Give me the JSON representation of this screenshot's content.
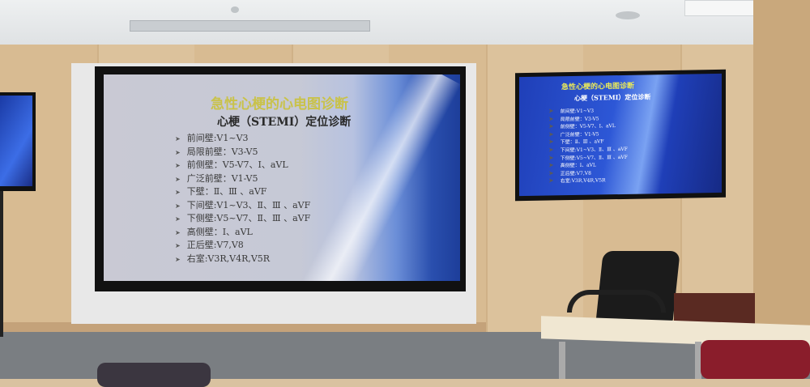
{
  "projection_screen": {
    "title": "急性心梗的心电图诊断",
    "subtitle": "心梗（STEMI）定位诊断",
    "items": [
      "前间壁:V1~V3",
      "局限前壁：V3-V5",
      "前侧壁：V5-V7、Ⅰ、aVL",
      "广泛前壁：V1-V5",
      "下壁：Ⅱ、Ⅲ 、aVF",
      "下间壁:V1~V3、Ⅱ、Ⅲ 、aVF",
      "下侧壁:V5~V7、Ⅱ、Ⅲ 、aVF",
      "高侧壁：Ⅰ、aVL",
      "正后壁:V7,V8",
      "右室:V3R,V4R,V5R"
    ]
  },
  "tv_screen": {
    "title": "急性心梗的心电图诊断",
    "subtitle": "心梗（STEMI）定位诊断",
    "items": [
      "前间壁:V1~V3",
      "局限前壁：V3-V5",
      "前侧壁：V5-V7、Ⅰ、aVL",
      "广泛前壁：V1-V5",
      "下壁：Ⅱ、Ⅲ 、aVF",
      "下间壁:V1~V3、Ⅱ、Ⅲ 、aVF",
      "下侧壁:V5~V7、Ⅱ、Ⅲ 、aVF",
      "高侧壁：Ⅰ、aVL",
      "正后壁:V7,V8",
      "右室:V3R,V4R,V5R"
    ]
  },
  "bullet_glyph": "➤",
  "colors": {
    "title": "#c9c24a",
    "screen_blue": "#1d3e9a",
    "wood": "#d8bb92"
  }
}
